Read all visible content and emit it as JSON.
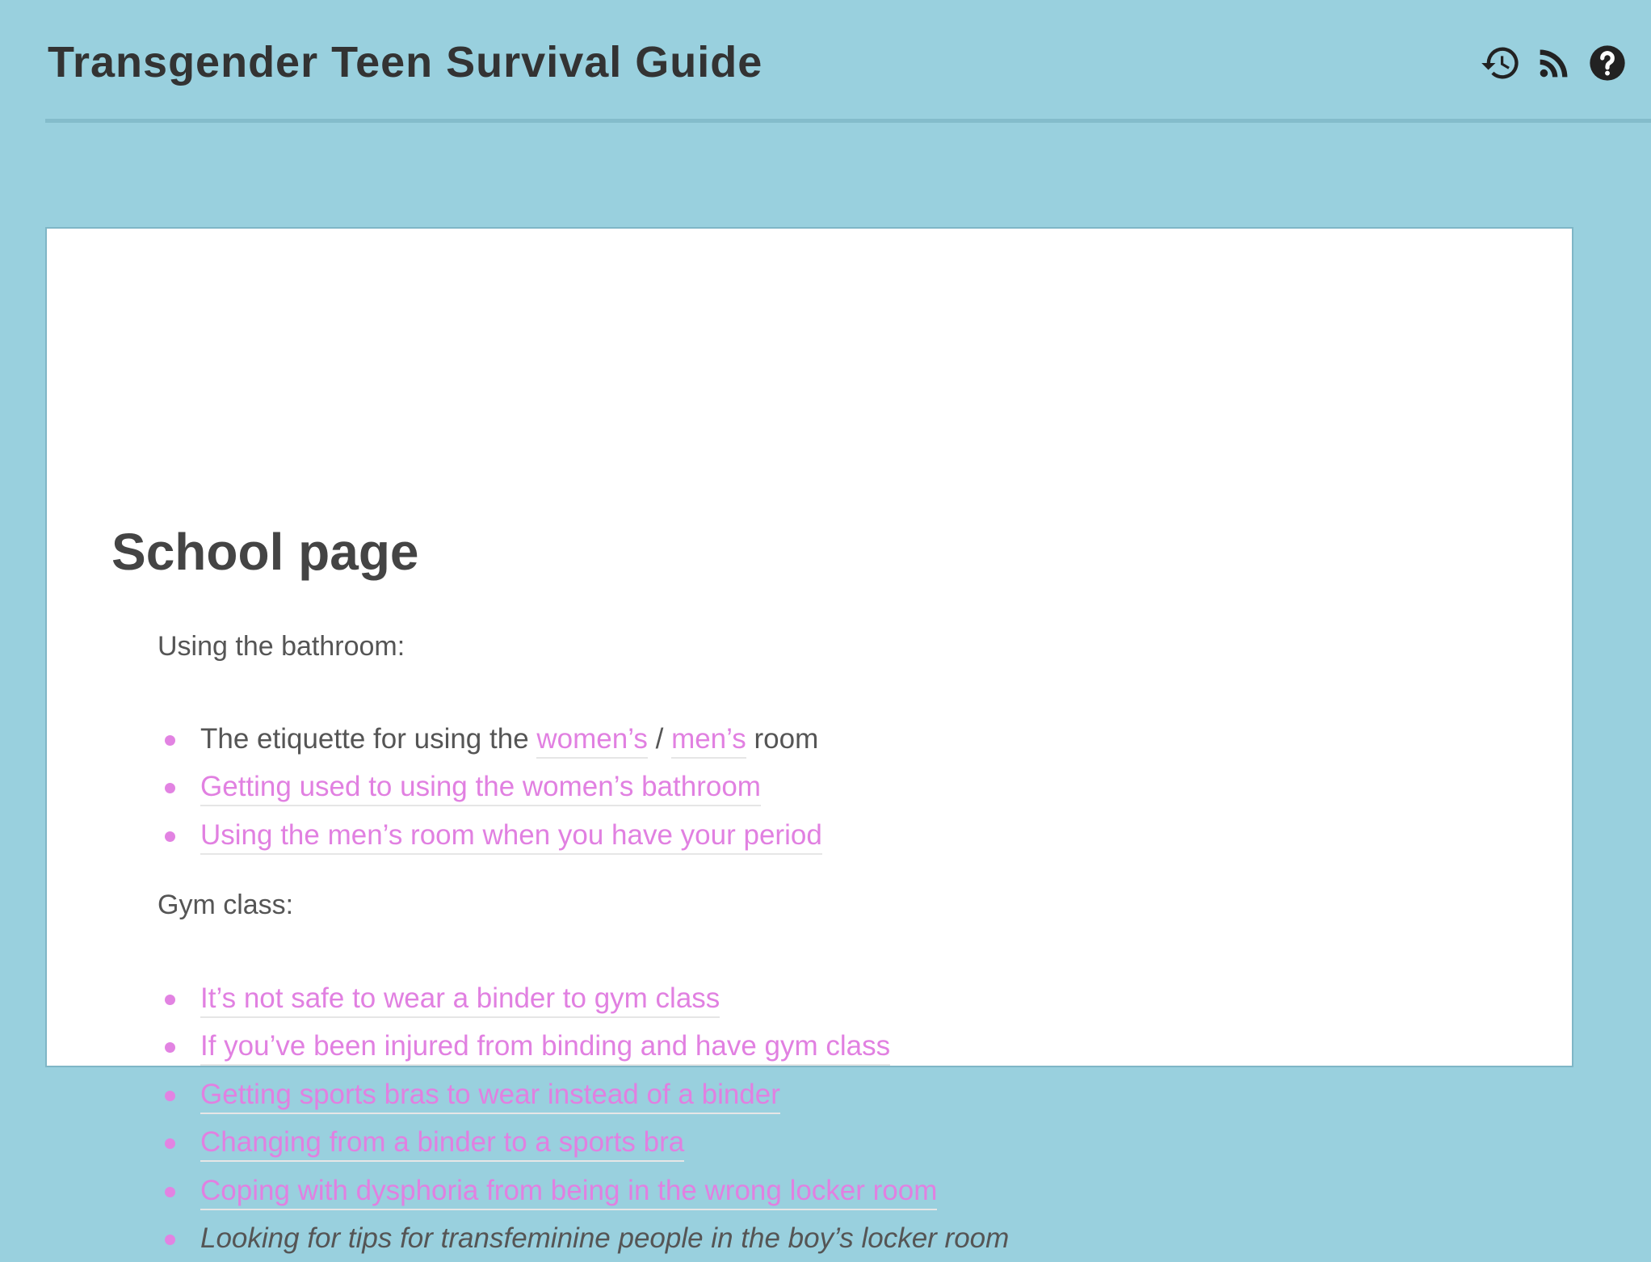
{
  "header": {
    "title": "Transgender Teen Survival Guide",
    "icons": [
      "history-icon",
      "rss-feed-icon",
      "help-icon"
    ]
  },
  "page": {
    "title": "School page",
    "sections": [
      {
        "label": "Using the bathroom:",
        "items": [
          {
            "prefix": "The etiquette for using the ",
            "link1": "women’s",
            "separator": " / ",
            "link2": "men’s",
            "suffix": " room"
          },
          {
            "link": "Getting used to using the women’s bathroom"
          },
          {
            "link": "Using the men’s room when you have your period"
          }
        ]
      },
      {
        "label": "Gym class:",
        "items": [
          {
            "link": "It’s not safe to wear a binder to gym class"
          },
          {
            "link": "If you’ve been injured from binding and have gym class"
          },
          {
            "link": "Getting sports bras to wear instead of a binder"
          },
          {
            "link": "Changing from a binder to a sports bra"
          },
          {
            "link": "Coping with dysphoria from being in the wrong locker room"
          },
          {
            "text": "Looking for tips for transfeminine people in the boy’s locker room"
          }
        ]
      }
    ]
  },
  "colors": {
    "background": "#99d0de",
    "link": "#e180e1",
    "bullet": "#e283e2",
    "heading": "#444444",
    "text": "#555555"
  }
}
